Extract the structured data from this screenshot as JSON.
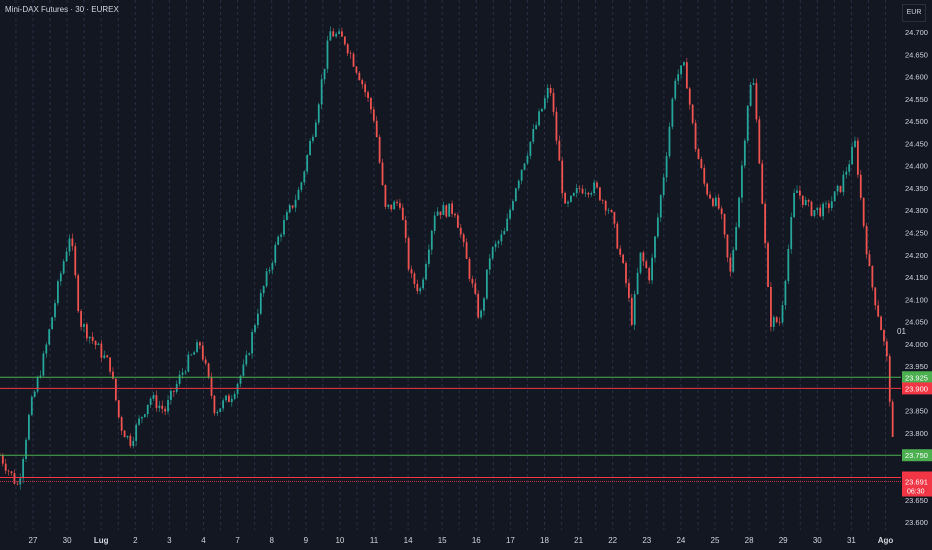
{
  "header": {
    "title": "Mini-DAX Futures · 30 · EUREX",
    "currency_button": "EUR"
  },
  "misc_label": "01",
  "colors": {
    "bg": "#131722",
    "up": "#26a69a",
    "down": "#ef5350",
    "grid": "#2a2e45",
    "green_line": "#4caf50",
    "red_line": "#f23645",
    "text": "#d1d4dc"
  },
  "chart_data": {
    "type": "candlestick",
    "title": "Mini-DAX Futures · 30 · EUREX",
    "x_tick_labels": [
      "27",
      "30",
      "Lug",
      "2",
      "3",
      "4",
      "7",
      "8",
      "9",
      "10",
      "11",
      "14",
      "15",
      "16",
      "17",
      "18",
      "21",
      "22",
      "23",
      "24",
      "25",
      "28",
      "29",
      "30",
      "31",
      "Ago"
    ],
    "y_tick_labels": [
      "24.700",
      "24.650",
      "24.600",
      "24.550",
      "24.500",
      "24.450",
      "24.400",
      "24.350",
      "24.300",
      "24.250",
      "24.200",
      "24.150",
      "24.100",
      "24.050",
      "24.000",
      "23.950",
      "23.850",
      "23.800",
      "23.650",
      "23.600"
    ],
    "ylim": [
      23.6,
      24.7
    ],
    "price_path": [
      [
        -0.97,
        23.75
      ],
      [
        -0.44,
        23.68
      ],
      [
        -0.09,
        23.85
      ],
      [
        0.35,
        23.98
      ],
      [
        0.79,
        24.15
      ],
      [
        1.09,
        24.25
      ],
      [
        1.38,
        24.05
      ],
      [
        1.82,
        24.0
      ],
      [
        2.26,
        23.95
      ],
      [
        2.55,
        23.82
      ],
      [
        2.84,
        23.78
      ],
      [
        3.43,
        23.88
      ],
      [
        3.87,
        23.85
      ],
      [
        4.46,
        23.95
      ],
      [
        4.9,
        24.0
      ],
      [
        5.34,
        23.85
      ],
      [
        5.78,
        23.88
      ],
      [
        6.22,
        23.95
      ],
      [
        6.66,
        24.1
      ],
      [
        7.24,
        24.25
      ],
      [
        7.83,
        24.35
      ],
      [
        8.27,
        24.5
      ],
      [
        8.71,
        24.7
      ],
      [
        9.15,
        24.68
      ],
      [
        9.59,
        24.6
      ],
      [
        10.03,
        24.5
      ],
      [
        10.32,
        24.3
      ],
      [
        10.76,
        24.32
      ],
      [
        11.06,
        24.15
      ],
      [
        11.35,
        24.12
      ],
      [
        11.79,
        24.3
      ],
      [
        12.38,
        24.3
      ],
      [
        12.82,
        24.15
      ],
      [
        13.11,
        24.05
      ],
      [
        13.4,
        24.2
      ],
      [
        13.84,
        24.25
      ],
      [
        14.13,
        24.35
      ],
      [
        14.57,
        24.45
      ],
      [
        15.16,
        24.58
      ],
      [
        15.6,
        24.3
      ],
      [
        16.04,
        24.35
      ],
      [
        16.48,
        24.35
      ],
      [
        16.92,
        24.3
      ],
      [
        17.36,
        24.15
      ],
      [
        17.57,
        24.05
      ],
      [
        17.8,
        24.2
      ],
      [
        18.09,
        24.15
      ],
      [
        18.53,
        24.4
      ],
      [
        18.83,
        24.6
      ],
      [
        19.12,
        24.62
      ],
      [
        19.41,
        24.45
      ],
      [
        19.71,
        24.35
      ],
      [
        20.15,
        24.3
      ],
      [
        20.44,
        24.15
      ],
      [
        20.73,
        24.35
      ],
      [
        20.97,
        24.55
      ],
      [
        21.11,
        24.6
      ],
      [
        21.32,
        24.4
      ],
      [
        21.61,
        24.05
      ],
      [
        21.91,
        24.05
      ],
      [
        22.35,
        24.35
      ],
      [
        22.79,
        24.3
      ],
      [
        23.23,
        24.3
      ],
      [
        23.67,
        24.35
      ],
      [
        24.11,
        24.45
      ],
      [
        24.31,
        24.3
      ],
      [
        24.55,
        24.15
      ],
      [
        24.84,
        24.05
      ],
      [
        25.07,
        23.95
      ],
      [
        25.28,
        23.69
      ]
    ],
    "horizontal_lines": [
      {
        "price": 23.925,
        "label": "23.925",
        "color": "#4caf50"
      },
      {
        "price": 23.9,
        "label": "23.900",
        "color": "#f23645"
      },
      {
        "price": 23.75,
        "label": "23.750",
        "color": "#4caf50"
      },
      {
        "price": 23.7,
        "label": "23.700",
        "color": "#f23645"
      }
    ],
    "last_price": {
      "price": 23.691,
      "label": "23.691",
      "countdown": "06:30"
    }
  }
}
